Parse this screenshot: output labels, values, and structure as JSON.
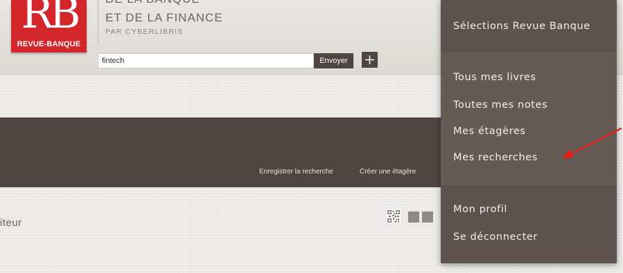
{
  "header": {
    "logo_mark": "RB",
    "logo_text": "REVUE-BANQUE",
    "brand_partial": "DE LA BANQUE",
    "brand_title": "ET DE LA FINANCE",
    "brand_subtitle": "PAR CYBERLIBRIS"
  },
  "search": {
    "value": "fintech",
    "submit_label": "Envoyer",
    "add_icon": "plus-icon"
  },
  "band": {
    "save_search_label": "Enregistrer la recherche",
    "create_shelf_label": "Créer une étagère"
  },
  "section": {
    "title_partial": "iteur"
  },
  "view_toggle": {
    "icons": [
      "qr-code-icon",
      "grid-view-icon"
    ]
  },
  "dropdown": {
    "heading": "Sélections Revue Banque",
    "items": [
      "Tous mes livres",
      "Toutes mes notes",
      "Mes étagères",
      "Mes recherches"
    ],
    "account_items": [
      "Mon profil",
      "Se déconnecter"
    ]
  },
  "annotation": {
    "arrow_color": "#e0211c"
  },
  "colors": {
    "brand_red": "#d2262b",
    "dark_band": "#4e4441",
    "menu_bg": "#665a55",
    "menu_bg_dark": "#5d524e"
  }
}
